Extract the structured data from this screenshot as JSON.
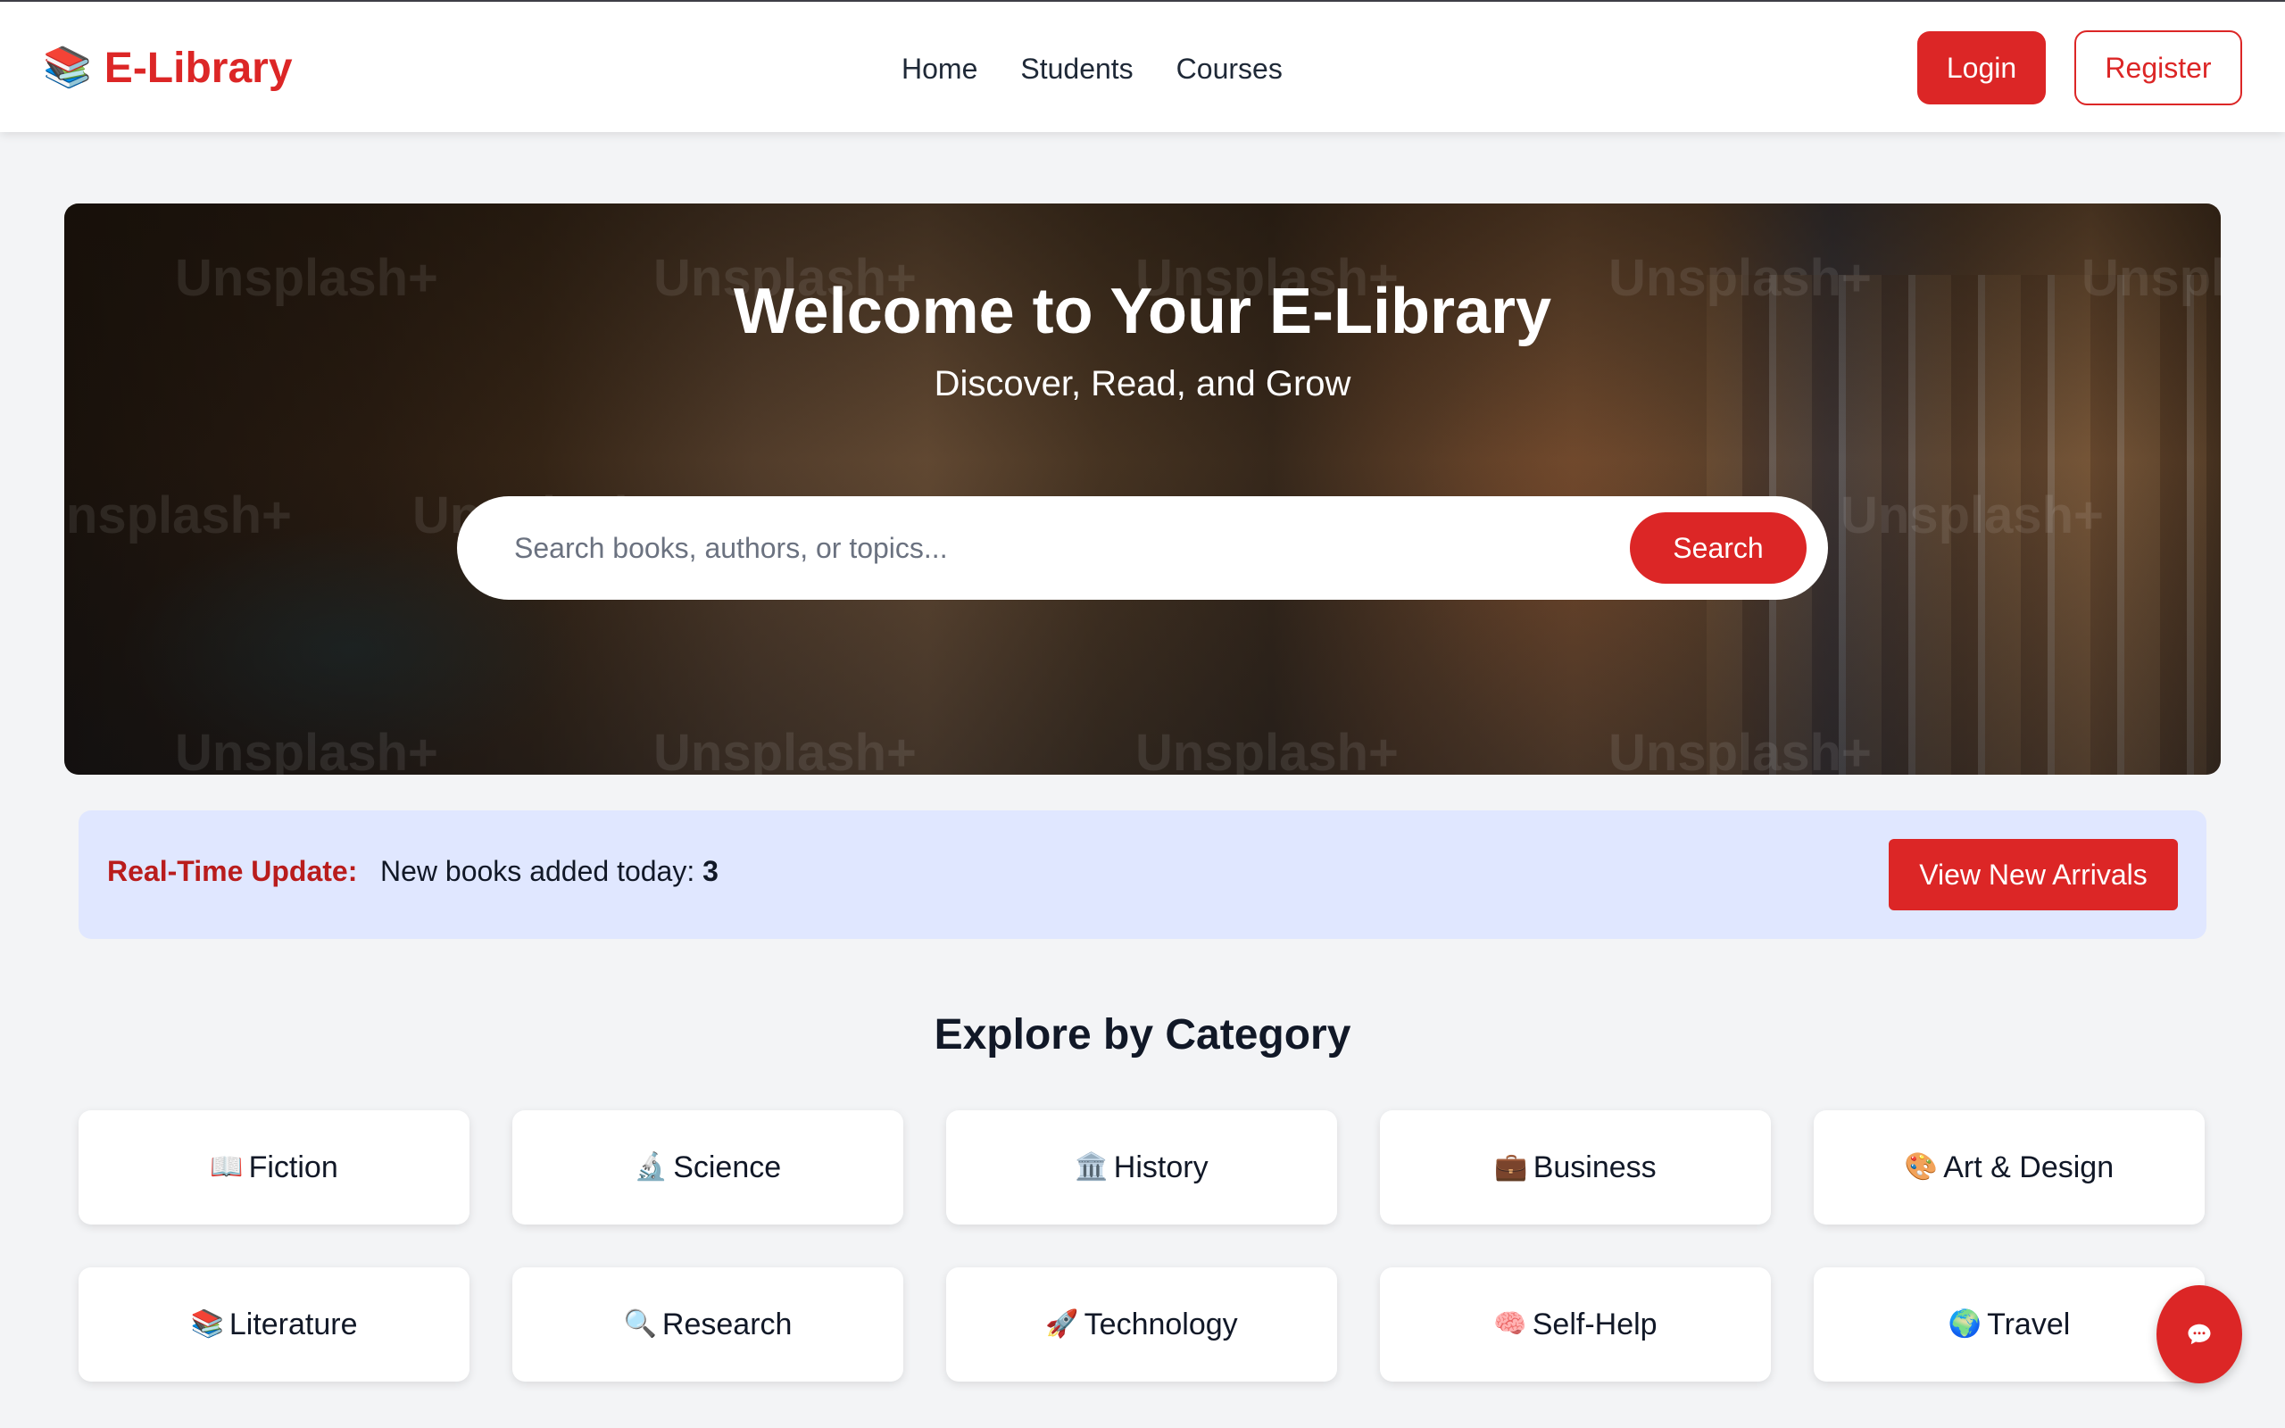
{
  "header": {
    "logo_icon": "books-icon",
    "logo_icon_glyph": "📚",
    "logo_text": "E-Library",
    "nav": [
      {
        "label": "Home"
      },
      {
        "label": "Students"
      },
      {
        "label": "Courses"
      }
    ],
    "login_label": "Login",
    "register_label": "Register"
  },
  "hero": {
    "title": "Welcome to Your E-Library",
    "subtitle": "Discover, Read, and Grow",
    "watermark": "Unsplash+",
    "search_placeholder": "Search books, authors, or topics...",
    "search_value": "",
    "search_button": "Search"
  },
  "update": {
    "label": "Real-Time Update:",
    "text": "New books added today: ",
    "count": "3",
    "button": "View New Arrivals"
  },
  "categories": {
    "title": "Explore by Category",
    "items": [
      {
        "icon": "open-book-icon",
        "glyph": "📖",
        "label": "Fiction"
      },
      {
        "icon": "microscope-icon",
        "glyph": "🔬",
        "label": "Science"
      },
      {
        "icon": "classical-building-icon",
        "glyph": "🏛️",
        "label": "History"
      },
      {
        "icon": "briefcase-icon",
        "glyph": "💼",
        "label": "Business"
      },
      {
        "icon": "palette-icon",
        "glyph": "🎨",
        "label": "Art & Design"
      },
      {
        "icon": "books-icon",
        "glyph": "📚",
        "label": "Literature"
      },
      {
        "icon": "magnifier-icon",
        "glyph": "🔍",
        "label": "Research"
      },
      {
        "icon": "rocket-icon",
        "glyph": "🚀",
        "label": "Technology"
      },
      {
        "icon": "brain-icon",
        "glyph": "🧠",
        "label": "Self-Help"
      },
      {
        "icon": "globe-icon",
        "glyph": "🌍",
        "label": "Travel"
      }
    ]
  },
  "chat": {
    "icon": "chat-bubble-icon"
  },
  "colors": {
    "accent": "#dc2626",
    "accent_dark": "#b91c1c",
    "page_bg": "#f3f4f6",
    "update_bg": "#e0e7ff"
  }
}
